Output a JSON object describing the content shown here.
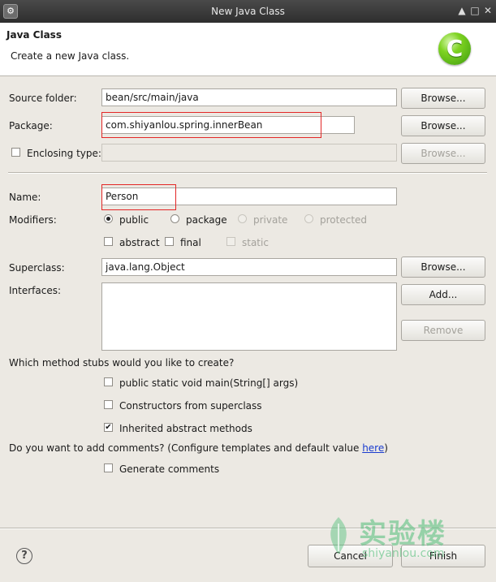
{
  "window": {
    "title": "New Java Class"
  },
  "header": {
    "title": "Java Class",
    "description": "Create a new Java class.",
    "logo_letter": "C"
  },
  "source_folder": {
    "label": "Source folder:",
    "value": "bean/src/main/java",
    "button": "Browse..."
  },
  "package": {
    "label": "Package:",
    "value": "com.shiyanlou.spring.innerBean",
    "button": "Browse..."
  },
  "enclosing_type": {
    "label": "Enclosing type:",
    "checked": false,
    "value": "",
    "button": "Browse..."
  },
  "name": {
    "label": "Name:",
    "value": "Person"
  },
  "modifiers": {
    "label": "Modifiers:",
    "public": "public",
    "package": "package",
    "private": "private",
    "protected": "protected",
    "abstract": "abstract",
    "final": "final",
    "static": "static"
  },
  "superclass": {
    "label": "Superclass:",
    "value": "java.lang.Object",
    "button": "Browse..."
  },
  "interfaces": {
    "label": "Interfaces:",
    "add_button": "Add...",
    "remove_button": "Remove"
  },
  "stubs": {
    "question": "Which method stubs would you like to create?",
    "main": "public static void main(String[] args)",
    "constructors": "Constructors from superclass",
    "inherited": "Inherited abstract methods"
  },
  "comments": {
    "question": "Do you want to add comments? (Configure templates and default value ",
    "link": "here",
    "close": ")",
    "generate": "Generate comments"
  },
  "footer": {
    "help": "?",
    "cancel": "Cancel",
    "finish": "Finish"
  },
  "watermark": {
    "text": "实验楼",
    "sub": "shiyanlou.com"
  }
}
